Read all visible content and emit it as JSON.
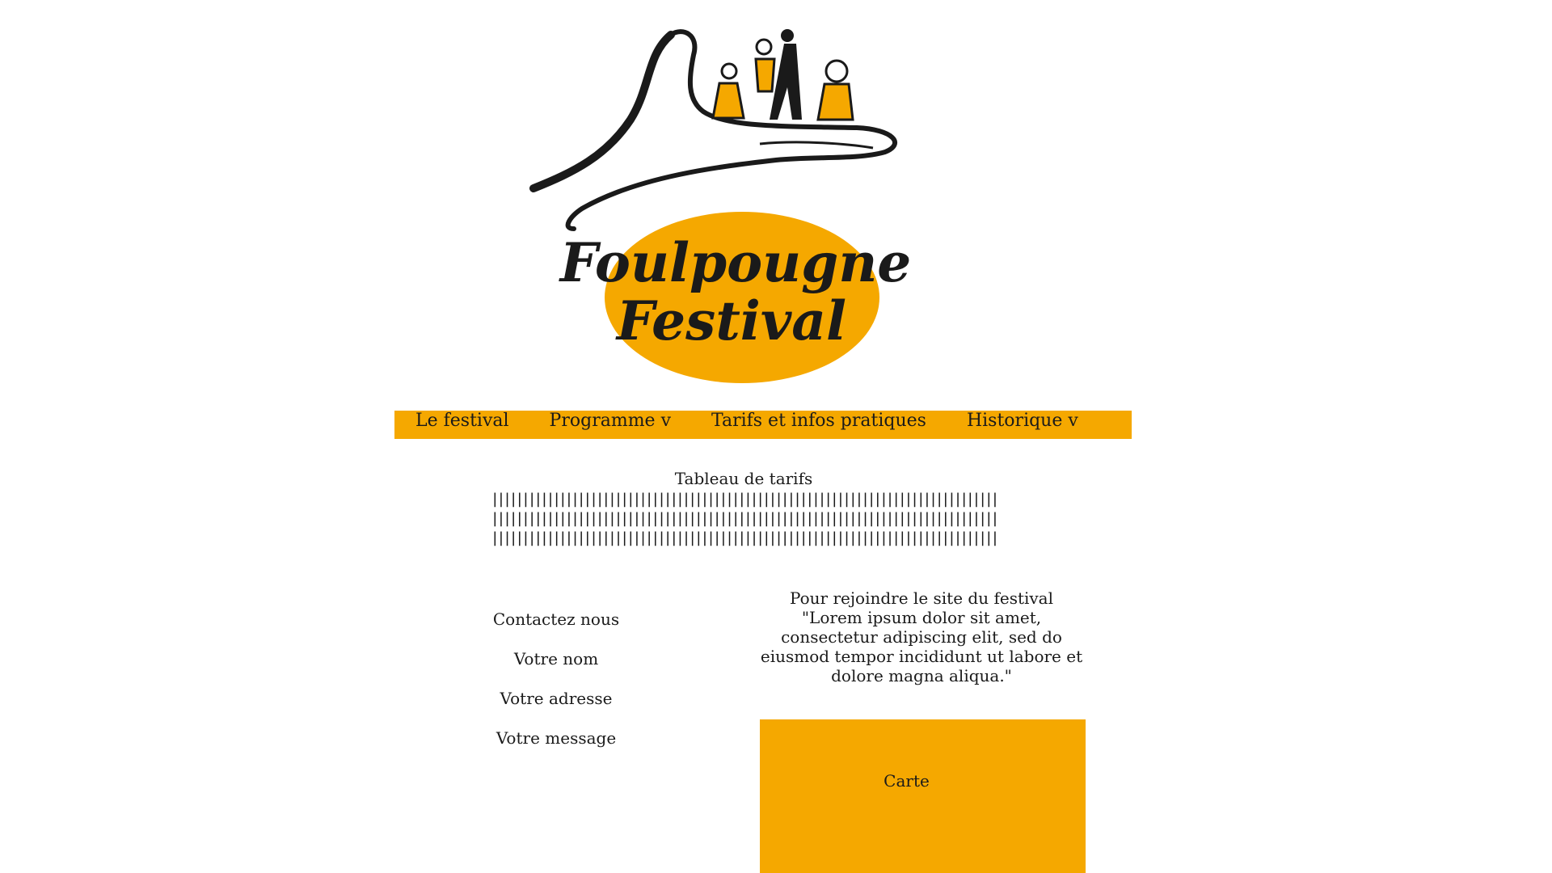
{
  "logo": {
    "line1": "Foulpougne",
    "line2": "Festival",
    "accent_color": "#f5a800"
  },
  "nav": {
    "items": [
      {
        "label": "Le festival"
      },
      {
        "label": "Programme v"
      },
      {
        "label": "Tarifs et infos pratiques"
      },
      {
        "label": "Historique v"
      }
    ],
    "background_color": "#f5a800"
  },
  "tarifs": {
    "title": "Tableau de tarifs",
    "rows": [
      "||||||||||||||||||||||||||||||||||||||||||||||||||||||||||||||||||||||||||||||||||",
      "||||||||||||||||||||||||||||||||||||||||||||||||||||||||||||||||||||||||||||||||||",
      "||||||||||||||||||||||||||||||||||||||||||||||||||||||||||||||||||||||||||||||||||"
    ]
  },
  "contact": {
    "title": "Contactez nous",
    "name_label": "Votre nom",
    "address_label": "Votre adresse",
    "message_label": "Votre message"
  },
  "info": {
    "heading": "Pour rejoindre le site du festival",
    "text": "\"Lorem ipsum dolor sit amet, consectetur adipiscing elit, sed do eiusmod tempor incididunt ut labore et dolore magna aliqua.\""
  },
  "map": {
    "label": "Carte",
    "background_color": "#f5a800"
  }
}
